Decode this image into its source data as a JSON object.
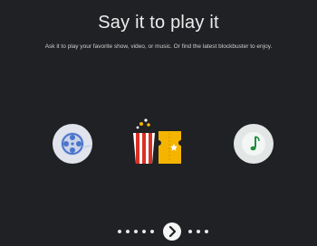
{
  "onboarding": {
    "title": "Say it to play it",
    "subtitle": "Ask it to play your favorite show, video, or music. Or find the latest blockbuster to enjoy."
  },
  "icons": {
    "left": "film-reel-icon",
    "center": "popcorn-ticket-icon",
    "right": "music-note-icon"
  },
  "pager": {
    "dots_before": 5,
    "dots_after": 3,
    "next_icon": "chevron-right-icon"
  },
  "colors": {
    "background": "#202124",
    "popcorn_red": "#d93025",
    "ticket_yellow": "#f4b400",
    "music_note": "#1e8e3e",
    "film_blue": "#4a74c9"
  }
}
